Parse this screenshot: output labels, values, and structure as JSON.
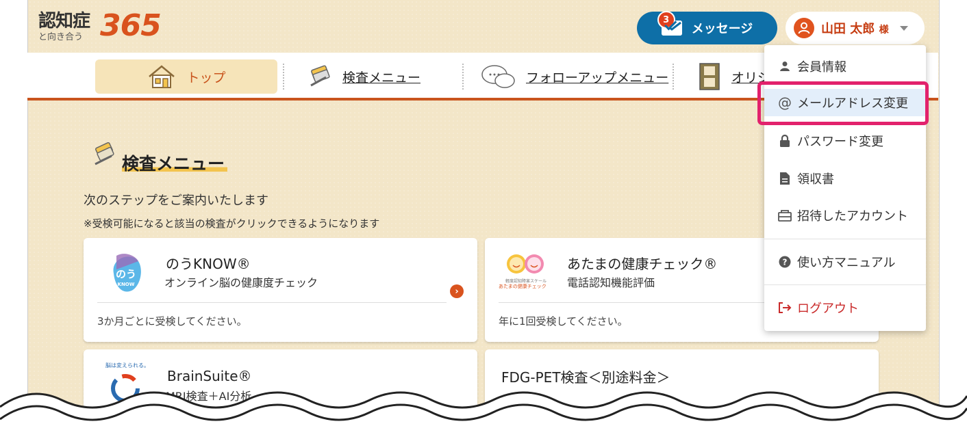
{
  "header": {
    "logo_main": "認知症",
    "logo_sub": "と向き合う",
    "logo_number": "365",
    "message_label": "メッセージ",
    "message_count": "3",
    "user_name": "山田 太郎",
    "user_suffix": "様"
  },
  "nav": {
    "items": [
      {
        "label": "トップ"
      },
      {
        "label": "検査メニュー"
      },
      {
        "label": "フォローアップメニュー"
      },
      {
        "label": "オリジ"
      }
    ]
  },
  "section": {
    "title": "検査メニュー",
    "step_text": "次のステップをご案内いたします",
    "note_text": "※受検可能になると該当の検査がクリックできるようになります"
  },
  "cards": [
    {
      "title": "のうKNOW®",
      "subtitle": "オンライン脳の健康度チェック",
      "footer": "3か月ごとに受検してください。",
      "logo_text": "のう",
      "logo_text2": "KNOW"
    },
    {
      "title": "あたまの健康チェック®",
      "subtitle": "電話認知機能評価",
      "footer": "年に1回受検してください。",
      "logo_caption1": "軽度認知障害スケール",
      "logo_caption2": "あたまの健康チェック"
    },
    {
      "title": "BrainSuite®",
      "subtitle": "MRI検査＋AI分析",
      "logo_caption": "脳は変えられる。"
    },
    {
      "title": "FDG-PET検査＜別途料金＞"
    }
  ],
  "user_menu": {
    "items": [
      {
        "label": "会員情報",
        "icon": "person-icon"
      },
      {
        "label": "メールアドレス変更",
        "icon": "at-icon"
      },
      {
        "label": "パスワード変更",
        "icon": "lock-icon"
      },
      {
        "label": "領収書",
        "icon": "document-icon"
      },
      {
        "label": "招待したアカウント",
        "icon": "invite-icon"
      },
      {
        "label": "使い方マニュアル",
        "icon": "help-icon"
      },
      {
        "label": "ログアウト",
        "icon": "logout-icon"
      }
    ],
    "highlight_color": "#e2226c"
  },
  "colors": {
    "accent": "#c9541d",
    "message_button": "#0e6fa7",
    "background": "#f3e6c8"
  }
}
